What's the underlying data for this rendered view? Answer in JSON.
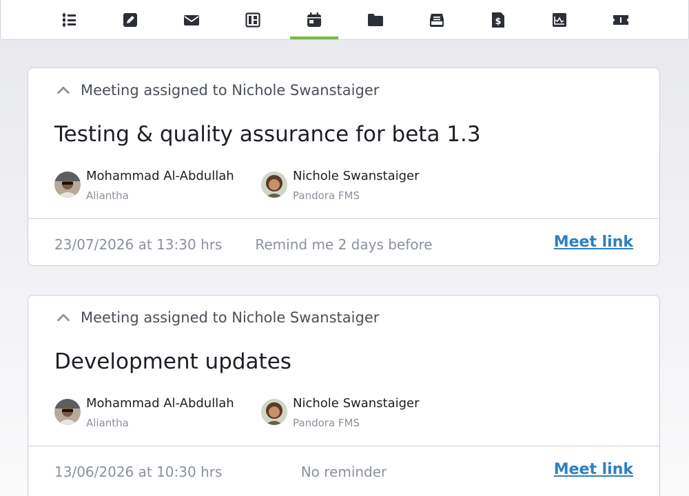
{
  "tabs": [
    {
      "icon": "task-list-icon"
    },
    {
      "icon": "edit-icon"
    },
    {
      "icon": "mail-icon"
    },
    {
      "icon": "board-icon"
    },
    {
      "icon": "calendar-icon",
      "active": true
    },
    {
      "icon": "folder-icon"
    },
    {
      "icon": "archive-icon"
    },
    {
      "icon": "billing-icon"
    },
    {
      "icon": "chart-icon"
    },
    {
      "icon": "ticket-icon"
    }
  ],
  "accent_color": "#7ab648",
  "link_color": "#2f7fc1",
  "meetings": [
    {
      "assigned": "Meeting assigned to Nichole Swanstaiger",
      "title": "Testing & quality assurance for beta 1.3",
      "organizer": {
        "name": "Mohammad Al-Abdullah",
        "company": "Aliantha"
      },
      "assignee": {
        "name": "Nichole Swanstaiger",
        "company": "Pandora FMS"
      },
      "datetime": "23/07/2026 at 13:30 hrs",
      "reminder": "Remind me 2 days before",
      "link": "Meet link"
    },
    {
      "assigned": "Meeting assigned to Nichole Swanstaiger",
      "title": "Development updates",
      "organizer": {
        "name": "Mohammad Al-Abdullah",
        "company": "Aliantha"
      },
      "assignee": {
        "name": "Nichole Swanstaiger",
        "company": "Pandora FMS"
      },
      "datetime": "13/06/2026 at 10:30 hrs",
      "reminder": "No reminder",
      "link": "Meet link"
    }
  ]
}
